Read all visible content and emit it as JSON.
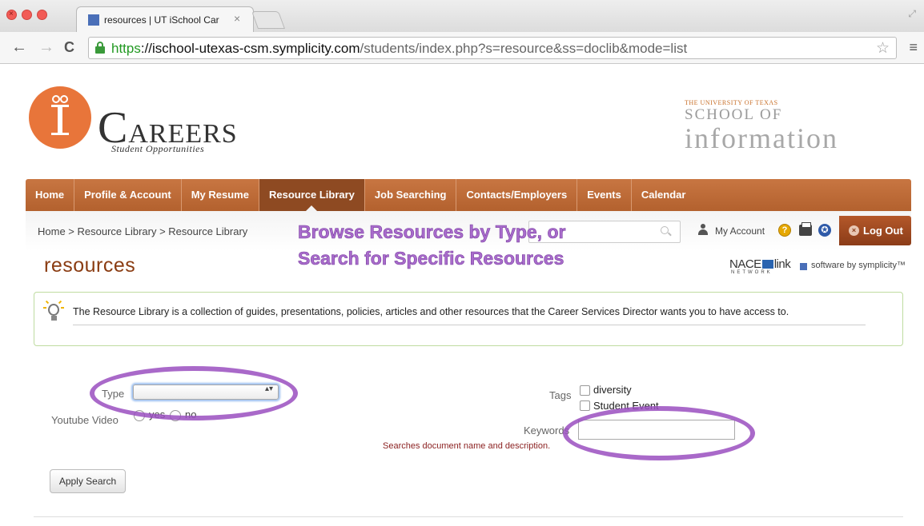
{
  "browser": {
    "tab_title": "resources | UT iSchool Car",
    "tab_close": "×",
    "url_scheme": "https",
    "url_sep": "://",
    "url_domain": "ischool-utexas-csm.symplicity.com",
    "url_path": "/students/index.php?s=resource&ss=doclib&mode=list",
    "back_glyph": "←",
    "forward_glyph": "→",
    "reload_glyph": "C",
    "star_glyph": "☆",
    "menu_glyph": "≡",
    "close_glyph": "×"
  },
  "header": {
    "careers_initial": "C",
    "careers_rest": "AREERS",
    "student_opportunities": "Student Opportunities",
    "ut_line1": "THE UNIVERSITY OF TEXAS",
    "ut_line2": "SCHOOL OF",
    "ut_line3": "information"
  },
  "nav": {
    "items": [
      "Home",
      "Profile & Account",
      "My Resume",
      "Resource Library",
      "Job Searching",
      "Contacts/Employers",
      "Events",
      "Calendar"
    ],
    "active_index": 3
  },
  "breadcrumb": "Home > Resource Library > Resource Library",
  "account": {
    "my_account": "My Account",
    "help_glyph": "?",
    "access_glyph": "✪",
    "logout": "Log Out",
    "logout_glyph": "×"
  },
  "annotation": {
    "line1": "Browse Resources by Type, or",
    "line2": "Search for Specific Resources"
  },
  "page_title": "resources",
  "branding": {
    "nace_left": "NACE",
    "nace_right": "link",
    "nace_network": "NETWORK",
    "symplicity": "software by symplicity™"
  },
  "info_text": "The Resource Library is a collection of guides, presentations, policies, articles and other resources that the Career Services Director wants you to have access to.",
  "form": {
    "type_label": "Type",
    "type_value": "",
    "select_arrows": "▴▾",
    "youtube_label": "Youtube Video",
    "radio_yes": "yes",
    "radio_no": "no",
    "tags_label": "Tags",
    "tags": [
      "diversity",
      "Student Event"
    ],
    "keywords_label": "Keywords",
    "keywords_value": "",
    "keywords_hint": "Searches document name and description.",
    "apply_button": "Apply Search"
  },
  "colors": {
    "nav_bg": "#c0703e",
    "nav_active": "#8e4a22",
    "title": "#8a3c12",
    "annotation": "#9a4fc0",
    "logo": "#e8753a"
  }
}
